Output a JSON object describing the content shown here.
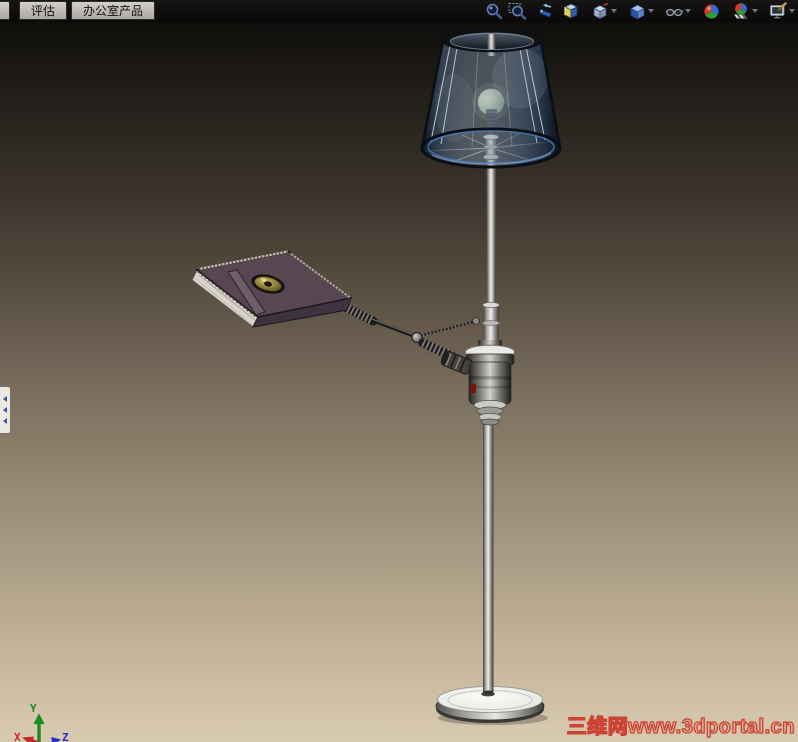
{
  "command_tabs": {
    "items": [
      {
        "label": "评估"
      },
      {
        "label": "办公室产品"
      }
    ]
  },
  "view_toolbar": {
    "buttons": [
      {
        "name": "zoom-to-fit"
      },
      {
        "name": "zoom-to-area"
      },
      {
        "name": "previous-view"
      },
      {
        "name": "section-view"
      },
      {
        "name": "view-orientation",
        "has_dropdown": true
      },
      {
        "name": "display-style",
        "has_dropdown": true
      },
      {
        "name": "hide-show-items",
        "has_dropdown": true
      },
      {
        "name": "realview-scene-sphere"
      },
      {
        "name": "apply-scene",
        "has_dropdown": true
      },
      {
        "name": "view-settings",
        "has_dropdown": true
      }
    ]
  },
  "left_panel": {
    "collapsed": true,
    "expander_icon": "triple-left-arrows"
  },
  "viewport": {
    "model_name": "floor-lamp-with-book-tray-assembly",
    "watermark": "三维网www.3dportal.cn",
    "triad": {
      "x_label": "X",
      "y_label": "Y",
      "z_label": "Z",
      "x_color": "#c22828",
      "y_color": "#1a8a1a",
      "z_color": "#2a2ac8"
    },
    "background": {
      "top": "#0f0e0c",
      "bottom": "#d9cbb1"
    },
    "watermark_color": "#cc4434"
  }
}
